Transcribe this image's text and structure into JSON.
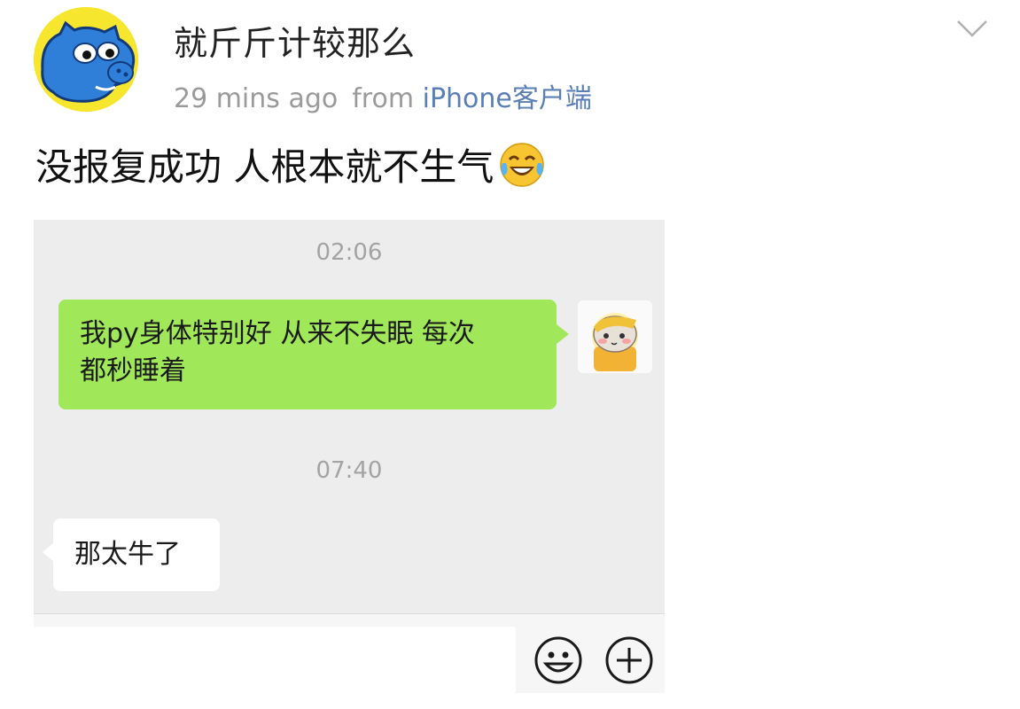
{
  "post": {
    "username": "就斤斤计较那么",
    "time": "29 mins ago",
    "from_label": "from",
    "source": "iPhone客户端",
    "text": "没报复成功 人根本就不生气",
    "emoji": "laughing-tears-emoji",
    "avatar": "blue-hippo-avatar"
  },
  "screenshot": {
    "timestamp_1": "02:06",
    "message_sent_line1": "我py身体特别好 从来不失眠 每次",
    "message_sent_line2": "都秒睡着",
    "timestamp_2": "07:40",
    "message_received": "那太牛了",
    "self_avatar": "hamster-sticker-avatar",
    "bubble_color_sent": "#a0e75a",
    "bubble_color_received": "#ffffff",
    "input_icons": [
      "smiley-icon",
      "plus-circle-icon"
    ]
  },
  "colors": {
    "source_link": "#5a7fb5",
    "meta_text": "#9a9a9a",
    "avatar_bg": "#f6e62d"
  }
}
